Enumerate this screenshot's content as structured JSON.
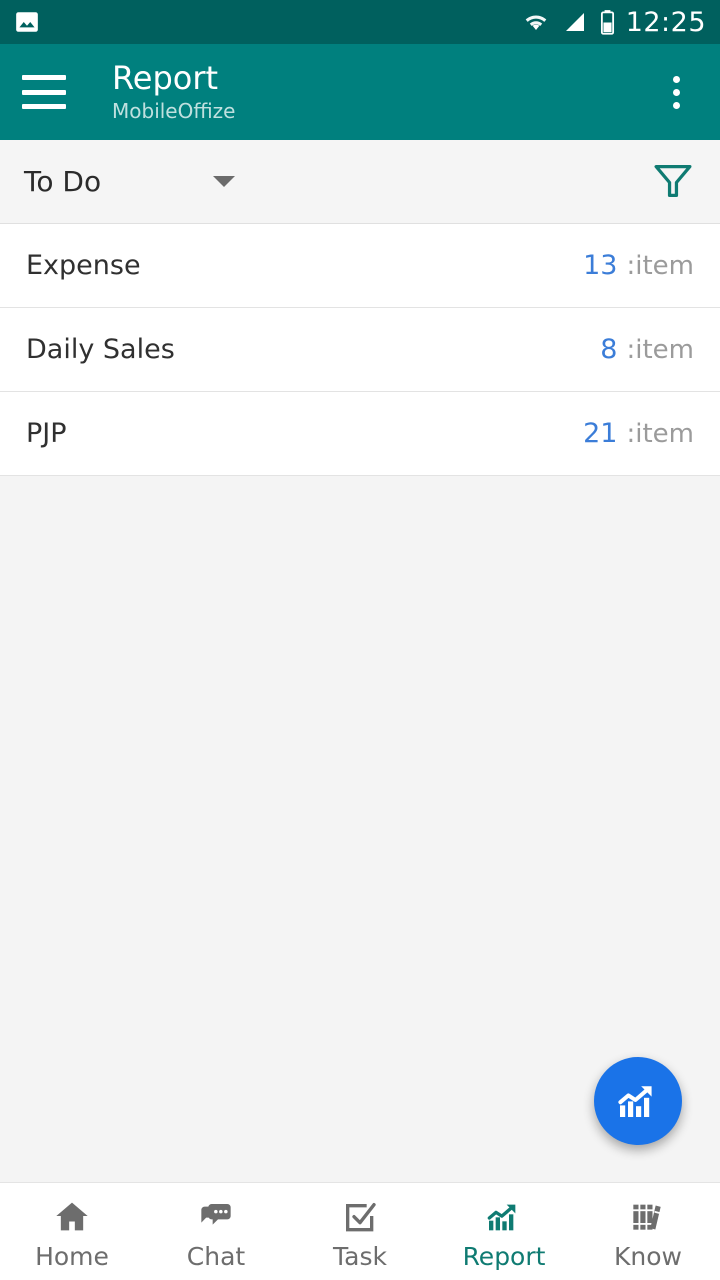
{
  "status_bar": {
    "time": "12:25",
    "icons": [
      "image-notification-icon",
      "wifi-icon",
      "cellular-signal-icon",
      "battery-icon"
    ],
    "background_color": "#00605e"
  },
  "app_bar": {
    "menu_icon": "hamburger-menu-icon",
    "title": "Report",
    "subtitle": "MobileOffize",
    "overflow_icon": "more-vertical-icon",
    "background_color": "#00807e"
  },
  "filter_bar": {
    "dropdown_value": "To Do",
    "dropdown_caret_icon": "chevron-down-icon",
    "filter_icon": "funnel-filter-icon",
    "filter_icon_color": "#0f7b72"
  },
  "list": {
    "unit_label": ":item",
    "count_color": "#3b7dd8",
    "rows": [
      {
        "title": "Expense",
        "count": "13",
        "unit": ":item"
      },
      {
        "title": "Daily Sales",
        "count": "8",
        "unit": ":item"
      },
      {
        "title": "PJP",
        "count": "21",
        "unit": ":item"
      }
    ]
  },
  "fab": {
    "icon": "chart-growth-icon",
    "background_color": "#1a73e8"
  },
  "bottom_nav": {
    "active_color": "#0f7b72",
    "inactive_color": "#6d6d6d",
    "items": [
      {
        "label": "Home",
        "icon": "home-icon",
        "active": false
      },
      {
        "label": "Chat",
        "icon": "chat-bubbles-icon",
        "active": false
      },
      {
        "label": "Task",
        "icon": "checkbox-icon",
        "active": false
      },
      {
        "label": "Report",
        "icon": "chart-growth-icon",
        "active": true
      },
      {
        "label": "Know",
        "icon": "books-icon",
        "active": false
      }
    ]
  }
}
